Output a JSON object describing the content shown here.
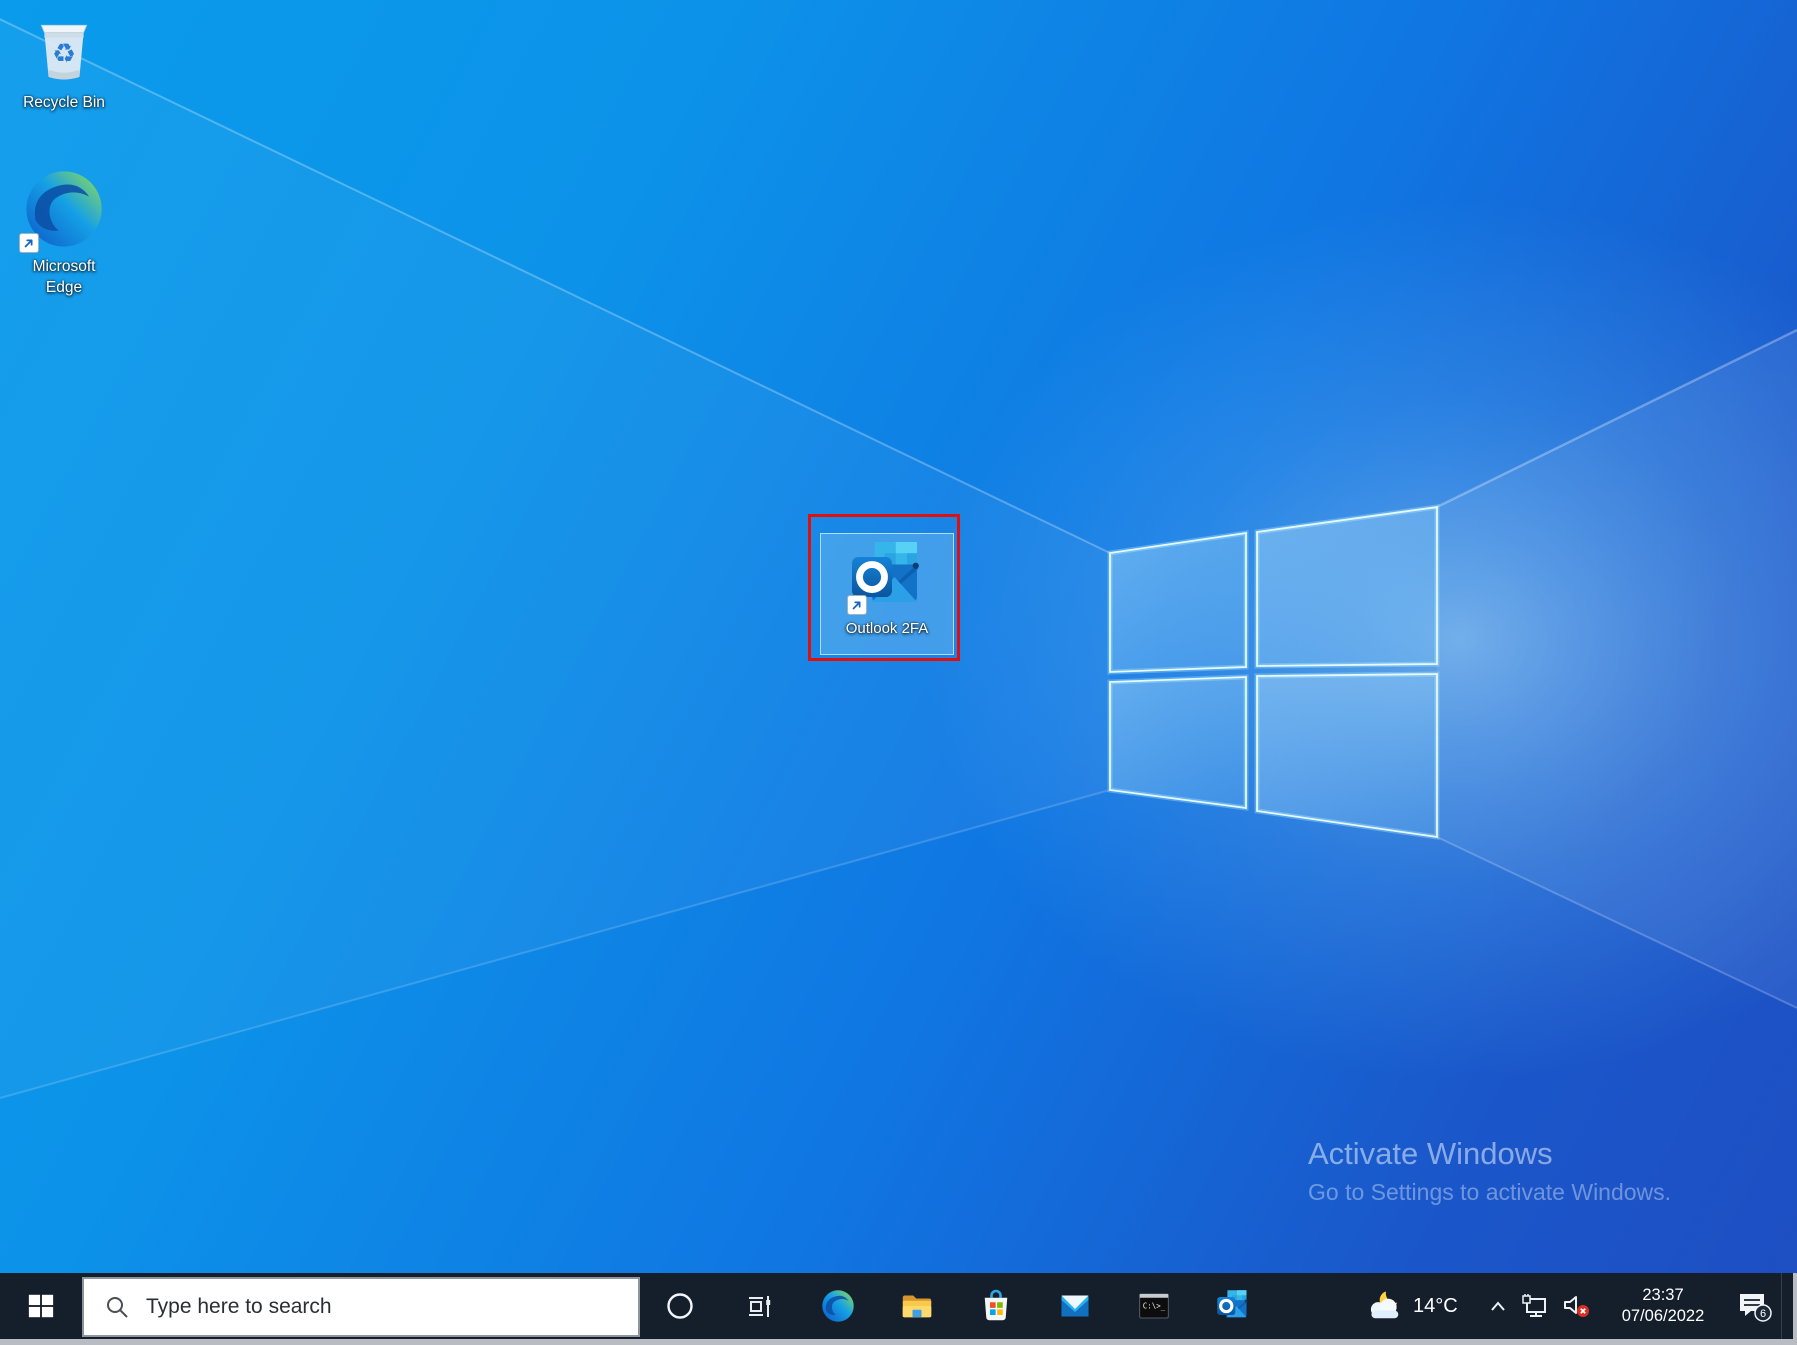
{
  "desktop": {
    "icons": [
      {
        "label": "Recycle Bin"
      },
      {
        "label": "Microsoft Edge"
      },
      {
        "label": "Outlook 2FA",
        "selected": true,
        "annotation": "red-highlight-box"
      }
    ],
    "watermark": {
      "title": "Activate Windows",
      "subtitle": "Go to Settings to activate Windows."
    }
  },
  "taskbar": {
    "search": {
      "placeholder": "Type here to search",
      "icon": "search-icon"
    },
    "buttons": [
      {
        "icon": "cortana-circle-icon"
      },
      {
        "icon": "task-view-icon"
      },
      {
        "icon": "edge-icon"
      },
      {
        "icon": "file-explorer-folder-icon"
      },
      {
        "icon": "microsoft-store-icon"
      },
      {
        "icon": "mail-icon"
      },
      {
        "icon": "command-prompt-icon"
      },
      {
        "icon": "outlook-icon"
      }
    ],
    "tray": {
      "weather_icon": "partly-cloudy-night-icon",
      "temperature": "14°C",
      "network_icon": "ethernet-icon",
      "volume_icon": "volume-muted-icon",
      "time": "23:37",
      "date": "07/06/2022",
      "notification_count": "6"
    }
  },
  "colors": {
    "annotation_red": "#e01010",
    "selection_fill": "rgba(125,196,240,0.42)",
    "taskbar_bg": "#151f2c",
    "wallpaper_top_left": "#0a9bec",
    "wallpaper_bottom_right": "#1e4ec2"
  }
}
